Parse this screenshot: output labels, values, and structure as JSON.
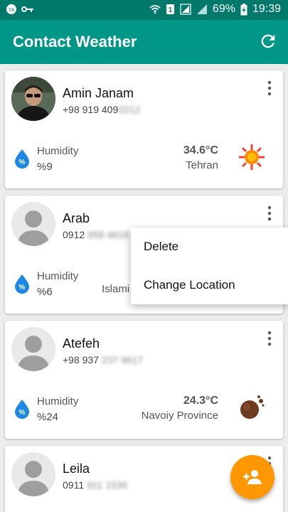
{
  "status_bar": {
    "battery": "69%",
    "time": "19:39"
  },
  "app": {
    "title": "Contact Weather"
  },
  "contacts": [
    {
      "name": "Amin Janam",
      "phone_visible": "+98 919 409",
      "phone_hidden": "0212",
      "humidity_label": "Humidity",
      "humidity_value": "%9",
      "temperature": "34.6°C",
      "city": "Tehran",
      "weather": "sun-icon"
    },
    {
      "name": "Arab",
      "phone_visible": "0912",
      "phone_hidden": "958 4618",
      "humidity_label": "Humidity",
      "humidity_value": "%6",
      "temperature": "",
      "city": "Islami",
      "weather": ""
    },
    {
      "name": "Atefeh",
      "phone_visible": "+98 937",
      "phone_hidden": "237 9617",
      "humidity_label": "Humidity",
      "humidity_value": "%24",
      "temperature": "24.3°C",
      "city": "Navoiy Province",
      "weather": "dust-icon"
    },
    {
      "name": "Leila",
      "phone_visible": "0911",
      "phone_hidden": "911 1536"
    }
  ],
  "context_menu": {
    "items": [
      "Delete",
      "Change Location"
    ]
  },
  "fab": {
    "icon": "add-person-icon"
  }
}
